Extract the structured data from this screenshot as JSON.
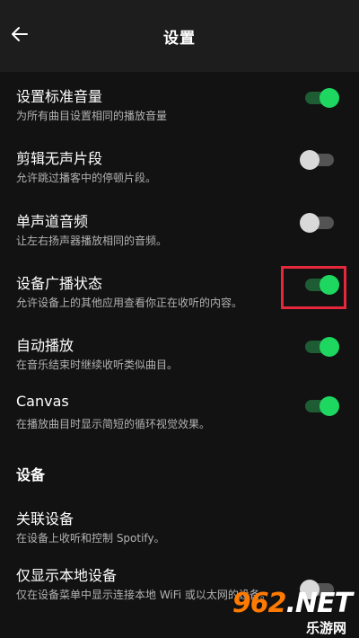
{
  "header": {
    "title": "设置",
    "back_icon": "arrow-left-icon"
  },
  "settings": [
    {
      "title": "设置标准音量",
      "subtitle": "为所有曲目设置相同的播放音量",
      "enabled": true
    },
    {
      "title": "剪辑无声片段",
      "subtitle": "允许跳过播客中的停顿片段。",
      "enabled": false
    },
    {
      "title": "单声道音频",
      "subtitle": "让左右扬声器播放相同的音频。",
      "enabled": false
    },
    {
      "title": "设备广播状态",
      "subtitle": "允许设备上的其他应用查看你正在收听的内容。",
      "enabled": true
    },
    {
      "title": "自动播放",
      "subtitle": "在音乐结束时继续收听类似曲目。",
      "enabled": true
    },
    {
      "title": "Canvas",
      "subtitle": "在播放曲目时显示简短的循环视觉效果。",
      "enabled": true
    }
  ],
  "devices": {
    "section_title": "设备",
    "connect": {
      "title": "关联设备",
      "subtitle": "在设备上收听和控制 Spotify。"
    },
    "local_only": {
      "title": "仅显示本地设备",
      "subtitle": "仅在设备菜单中显示连接本地 WiFi 或以太网的设备。",
      "enabled": false
    }
  },
  "watermark": {
    "logo_text": "962.NET",
    "site_text": "乐游网"
  },
  "colors": {
    "background": "#121212",
    "header": "#1d1d1d",
    "accent": "#1ed760",
    "highlight": "#e5283b"
  }
}
